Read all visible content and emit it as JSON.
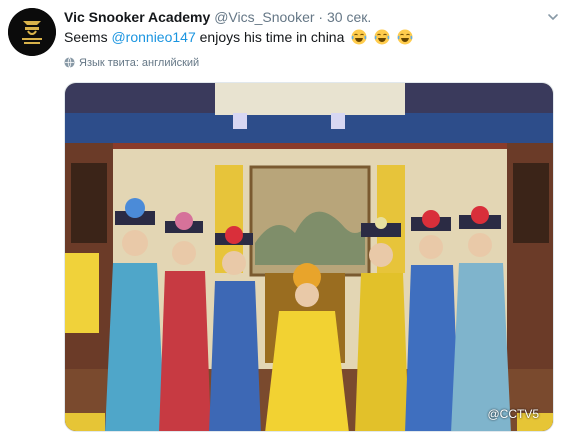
{
  "tweet": {
    "author_name": "Vic Snooker Academy",
    "handle": "@Vics_Snooker",
    "separator": "·",
    "time": "30 сек.",
    "text_before": "Seems ",
    "mention": "@ronnieo147",
    "text_after": " enjoys his time in china",
    "emoji_count": 3,
    "language_note": "Язык твита: английский"
  },
  "photo": {
    "watermark": "@CCTV5",
    "description_colors": {
      "accent": "#1b95e0",
      "name_text": "#14171a",
      "meta_text": "#657786"
    }
  }
}
